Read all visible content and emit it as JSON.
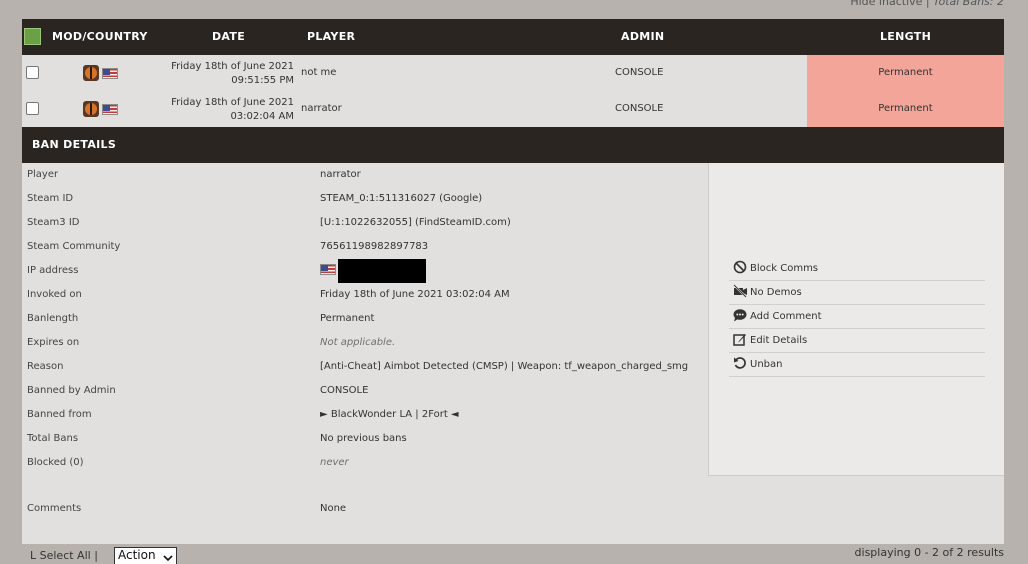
{
  "top": {
    "hide_inactive": "Hide inactive",
    "total_bans": "Total Bans: 2"
  },
  "table": {
    "headers": {
      "mod": "MOD/COUNTRY",
      "date": "DATE",
      "player": "PLAYER",
      "admin": "ADMIN",
      "length": "LENGTH"
    },
    "rows": [
      {
        "date_line1": "Friday 18th of June 2021",
        "date_line2": "09:51:55 PM",
        "player": "not me",
        "admin": "CONSOLE",
        "length": "Permanent"
      },
      {
        "date_line1": "Friday 18th of June 2021",
        "date_line2": "03:02:04 AM",
        "player": "narrator",
        "admin": "CONSOLE",
        "length": "Permanent"
      }
    ]
  },
  "ban_details": {
    "title": "BAN DETAILS",
    "fields": [
      {
        "label": "Player",
        "value": "narrator"
      },
      {
        "label": "Steam ID",
        "value": "STEAM_0:1:511316027 (Google)"
      },
      {
        "label": "Steam3 ID",
        "value": "[U:1:1022632055] (FindSteamID.com)"
      },
      {
        "label": "Steam Community",
        "value": "76561198982897783"
      },
      {
        "label": "IP address",
        "value": ""
      },
      {
        "label": "Invoked on",
        "value": "Friday 18th of June 2021 03:02:04 AM"
      },
      {
        "label": "Banlength",
        "value": "Permanent"
      },
      {
        "label": "Expires on",
        "value": "Not applicable."
      },
      {
        "label": "Reason",
        "value": "[Anti-Cheat] Aimbot Detected (CMSP) | Weapon: tf_weapon_charged_smg"
      },
      {
        "label": "Banned by Admin",
        "value": "CONSOLE"
      },
      {
        "label": "Banned from",
        "value": "► BlackWonder LA | 2Fort ◄"
      },
      {
        "label": "Total Bans",
        "value": "No previous bans"
      },
      {
        "label": "Blocked (0)",
        "value": "never"
      }
    ],
    "comments_label": "Comments",
    "comments_value": "None",
    "actions": [
      {
        "label": "Block Comms",
        "icon": "ban-icon"
      },
      {
        "label": "No Demos",
        "icon": "no-video-icon"
      },
      {
        "label": "Add Comment",
        "icon": "comment-icon"
      },
      {
        "label": "Edit Details",
        "icon": "edit-icon"
      },
      {
        "label": "Unban",
        "icon": "undo-icon"
      }
    ]
  },
  "footer": {
    "select_all": "L  Select All  |",
    "action": "Action",
    "results": "displaying 0 - 2 of 2 results"
  }
}
